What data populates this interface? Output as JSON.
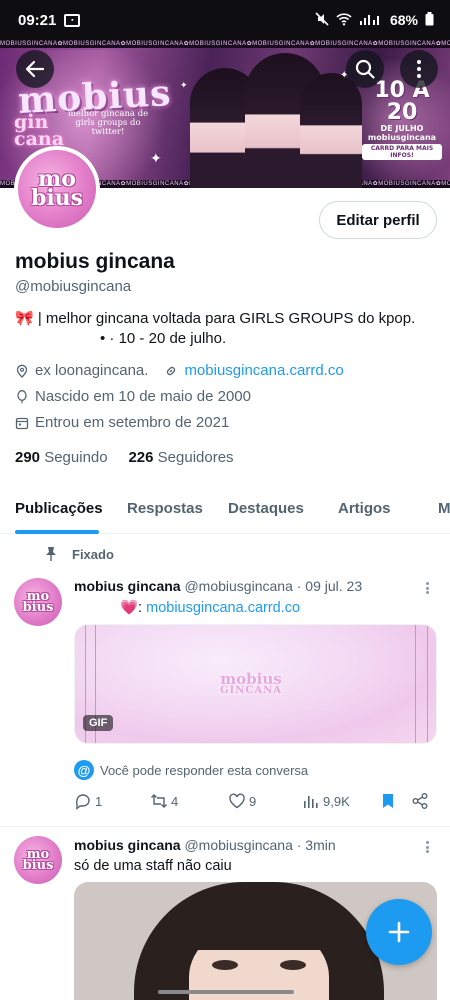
{
  "status_bar": {
    "time": "09:21",
    "battery": "68%"
  },
  "banner": {
    "logo_big": "mobius",
    "logo_sub_1": "gin",
    "logo_sub_2": "cana",
    "tagline": "melhor gincana de girls groups do twitter!",
    "dates_big": "10 A 20",
    "dates_small": "DE JULHO",
    "dates_handle": "mobiusgincana",
    "dates_pill": "CARRD PARA MAIS INFOS!",
    "ribbon": "MOBIUSGINCANA✿MOBIUSGINCANA✿MOBIUSGINCANA✿MOBIUSGINCANA✿MOBIUSGINCANA✿MOBIUSGINCANA✿MOBIUSGINCANA✿MOBIUSGINCANA✿MOBIUSGINCANA✿"
  },
  "profile": {
    "avatar_line1": "mo",
    "avatar_line2": "bius",
    "edit_label": "Editar perfil",
    "name": "mobius gincana",
    "handle": "@mobiusgincana",
    "bio_line1": "🎀 | melhor gincana voltada para GIRLS GROUPS do kpop.",
    "bio_line2": "•   · 10 - 20 de julho.",
    "location": "ex loonagincana.",
    "website": "mobiusgincana.carrd.co",
    "birthday": "Nascido em 10 de maio de 2000",
    "joined": "Entrou em setembro de 2021",
    "following_count": "290",
    "following_label": "Seguindo",
    "followers_count": "226",
    "followers_label": "Seguidores"
  },
  "tabs": [
    "Publicações",
    "Respostas",
    "Destaques",
    "Artigos",
    "M"
  ],
  "pinned_label": "Fixado",
  "posts": [
    {
      "name": "mobius gincana",
      "handle_time": "@mobiusgincana · 09 jul. 23",
      "text_prefix": "💗: ",
      "text_link": "mobiusgincana.carrd.co",
      "media_logo": "mobius",
      "media_logo_sub": "GINCANA",
      "gif_badge": "GIF",
      "reply_note": "Você pode responder esta conversa",
      "replies": "1",
      "reposts": "4",
      "likes": "9",
      "views": "9,9K"
    },
    {
      "name": "mobius gincana",
      "handle_time": "@mobiusgincana · 3min",
      "text": "só de uma staff não caiu"
    }
  ],
  "colors": {
    "accent": "#1d9bf0",
    "text": "#0f1419",
    "muted": "#536471",
    "bookmark": "#1d9bf0"
  }
}
